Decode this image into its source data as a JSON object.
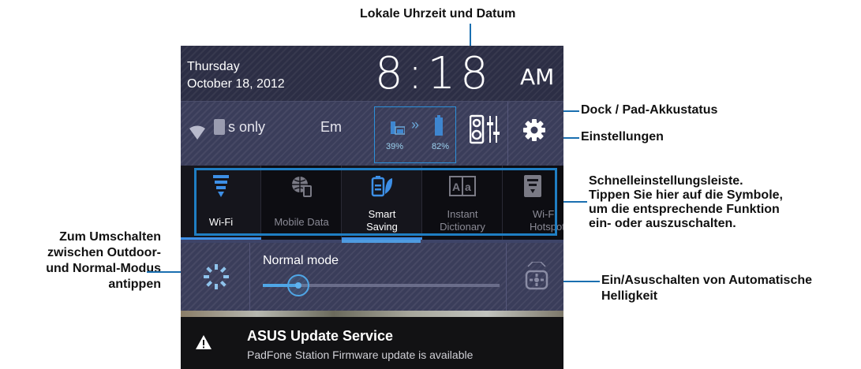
{
  "header": {
    "day": "Thursday",
    "date": "October 18, 2012",
    "time": "8:18",
    "ampm": "AM"
  },
  "status_row": {
    "carrier_text": "s only",
    "emergency_text": "Em",
    "dock_battery": "39%",
    "pad_battery": "82%",
    "chevrons": "»"
  },
  "quick_settings": [
    {
      "label": "Wi-Fi",
      "icon": "wifi-icon",
      "active": true
    },
    {
      "label": "Mobile Data",
      "icon": "mobile-data-icon",
      "active": false
    },
    {
      "label": "Smart Saving",
      "icon": "smart-saving-icon",
      "active": true
    },
    {
      "label": "Instant Dictionary",
      "icon": "instant-dictionary-icon",
      "active": false
    },
    {
      "label": "Wi-Fi Hotspot",
      "icon": "wifi-hotspot-icon",
      "active": false
    }
  ],
  "brightness": {
    "mode_label": "Normal mode",
    "level": 0.15
  },
  "notification": {
    "title": "ASUS Update Service",
    "text": "PadFone Station Firmware update is available"
  },
  "callouts": {
    "clock": "Lokale Uhrzeit und Datum",
    "battery": "Dock / Pad-Akkustatus",
    "settings": "Einstellungen",
    "quick_settings_line1": "Schnelleinstellungsleiste.",
    "quick_settings_line2": "Tippen Sie hier auf die Symbole,",
    "quick_settings_line3": "um die entsprechende Funktion",
    "quick_settings_line4": "ein- oder auszuschalten.",
    "outdoor_line1": "Zum Umschalten",
    "outdoor_line2": "zwischen Outdoor-",
    "outdoor_line3": "und Normal-Modus",
    "outdoor_line4": "antippen",
    "auto_line1": "Ein/Asuschalten von Automatische",
    "auto_line2": "Helligkeit"
  },
  "colors": {
    "accent": "#1f7ec3",
    "active_icon": "#3d8fe6",
    "label_active": "#ffffff",
    "label_inactive": "#8a8a95"
  }
}
